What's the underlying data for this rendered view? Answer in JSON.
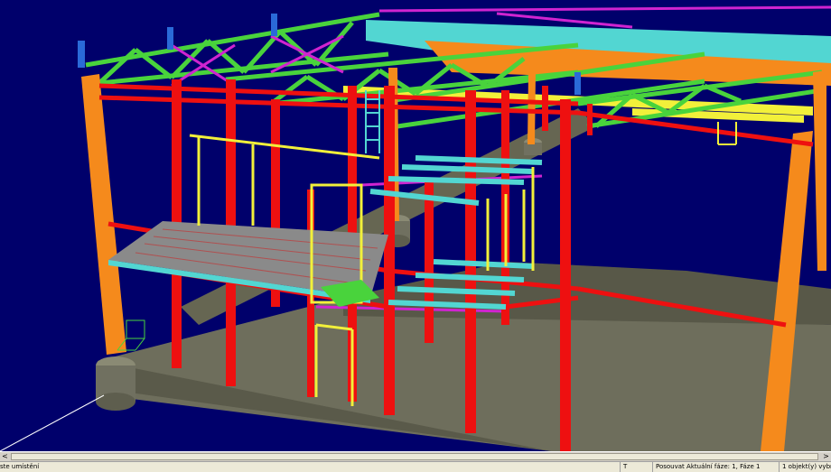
{
  "status": {
    "hint": "ste umístění",
    "key": "T",
    "mode": "Posouvat",
    "phase": "Aktuální fáze: 1, Fáze 1",
    "selection": "1 objekt(y) vybrán(y)"
  },
  "scrollbar": {
    "left_arrow": "<",
    "right_arrow": ">"
  },
  "colors": {
    "background": "#00006b",
    "columns_red": "#ee1010",
    "columns_orange": "#f58a1c",
    "trusses_green": "#49d33c",
    "bracing_magenta": "#d024d0",
    "beams_cyan": "#52d6d2",
    "beams_yellow": "#f2f03a",
    "foundation_grey": "#6e6e5c"
  }
}
